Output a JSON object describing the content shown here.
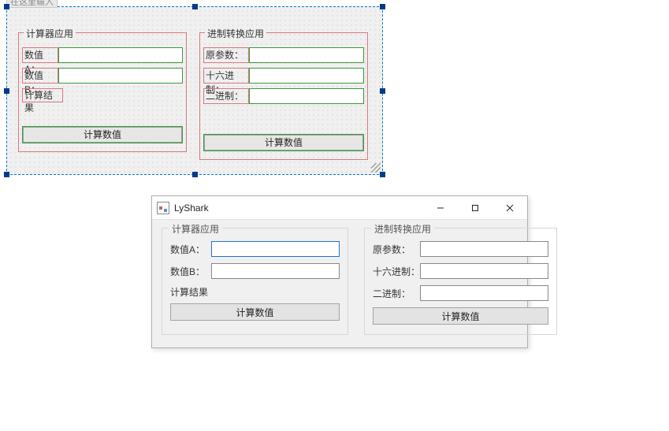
{
  "designer": {
    "placeholder_tab": "在这里输入",
    "group_calc": {
      "title": "计算器应用",
      "labelA": "数值A：",
      "labelB": "数值B：",
      "result_label": "计算结果",
      "button": "计算数值"
    },
    "group_conv": {
      "title": "进制转换应用",
      "label_src": "原参数：",
      "label_hex": "十六进制：",
      "label_bin": "二进制：",
      "button": "计算数值"
    }
  },
  "runtime": {
    "window_title": "LyShark",
    "group_calc": {
      "title": "计算器应用",
      "labelA": "数值A：",
      "valueA": "",
      "labelB": "数值B：",
      "valueB": "",
      "result_label": "计算结果",
      "button": "计算数值"
    },
    "group_conv": {
      "title": "进制转换应用",
      "label_src": "原参数：",
      "value_src": "",
      "label_hex": "十六进制：",
      "value_hex": "",
      "label_bin": "二进制：",
      "value_bin": "",
      "button": "计算数值"
    }
  }
}
